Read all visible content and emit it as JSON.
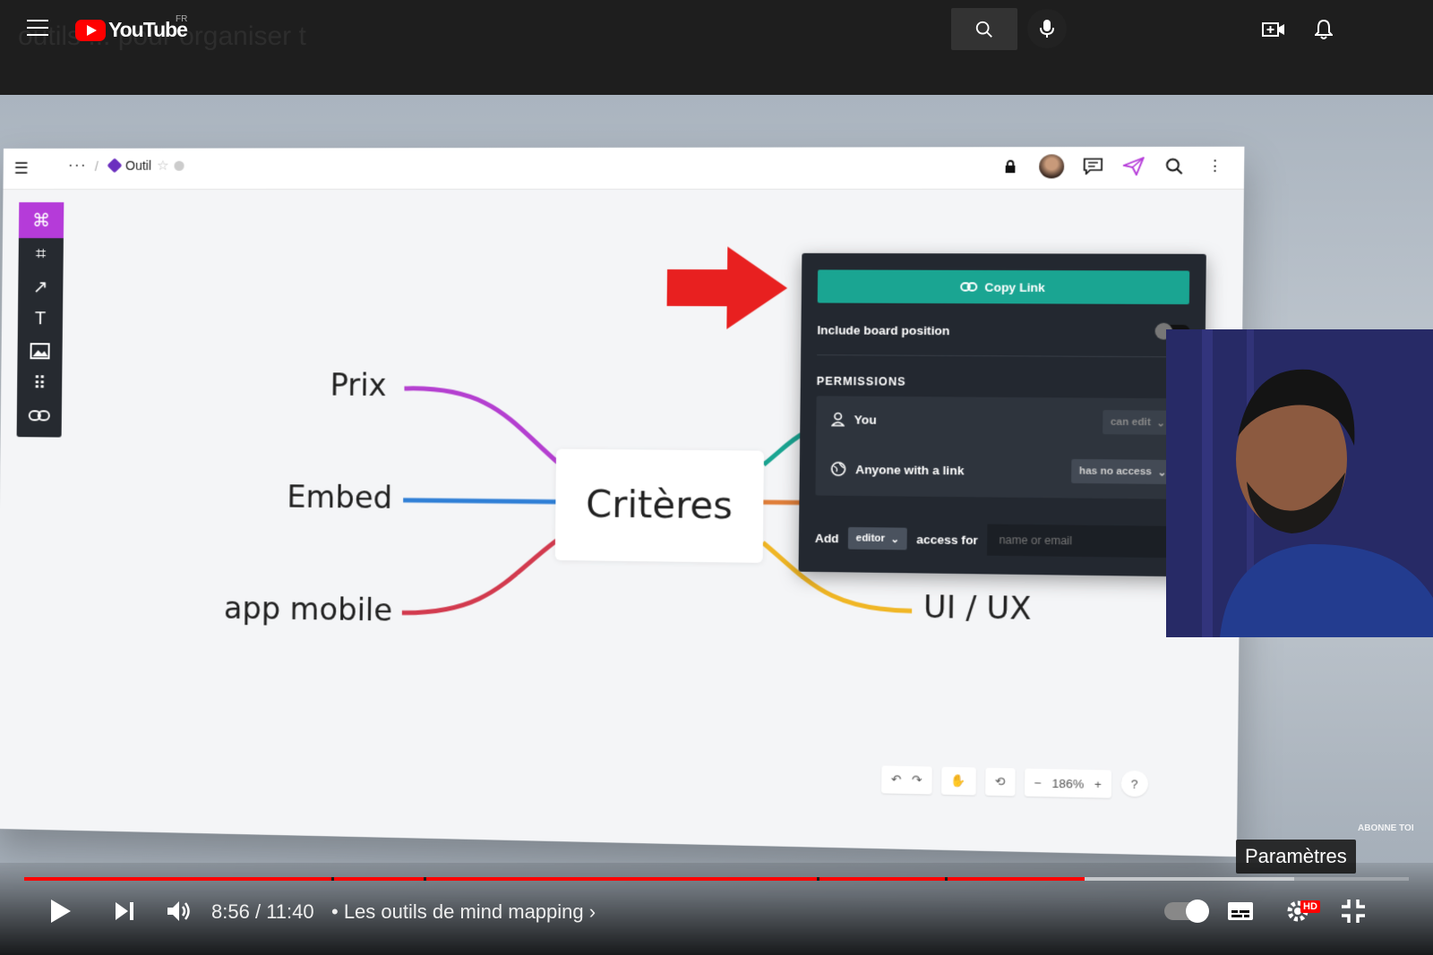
{
  "youtube": {
    "brand": "YouTube",
    "country": "FR",
    "ghost_title": "outils ... pour organiser t"
  },
  "app": {
    "breadcrumb_more": "···",
    "breadcrumb_sep": "/",
    "board_name": "Outil",
    "zoom": "186%",
    "help": "?"
  },
  "mindmap": {
    "center": "Critères",
    "branches": [
      {
        "label": "Prix",
        "color": "#b43fd0"
      },
      {
        "label": "Embed",
        "color": "#2f7fd6"
      },
      {
        "label": "app mobile",
        "color": "#d23a4e"
      },
      {
        "label": "UI / UX",
        "color": "#f0b625"
      }
    ]
  },
  "share": {
    "copy_link": "Copy Link",
    "include_board_position": "Include board position",
    "permissions_heading": "PERMISSIONS",
    "you_label": "You",
    "you_role": "can edit",
    "anyone_label": "Anyone with a link",
    "anyone_role": "has no access",
    "add_label": "Add",
    "add_role": "editor",
    "access_for": "access for",
    "email_placeholder": "name or email"
  },
  "overlay": {
    "abonne": "ABONNE TOI",
    "tooltip": "Paramètres"
  },
  "player": {
    "current_time": "8:56",
    "duration": "11:40",
    "time_sep": "/",
    "chapter": "• Les outils de mind mapping ›",
    "progress_played": 0.766,
    "progress_loaded": 0.917,
    "hd_badge": "HD"
  }
}
